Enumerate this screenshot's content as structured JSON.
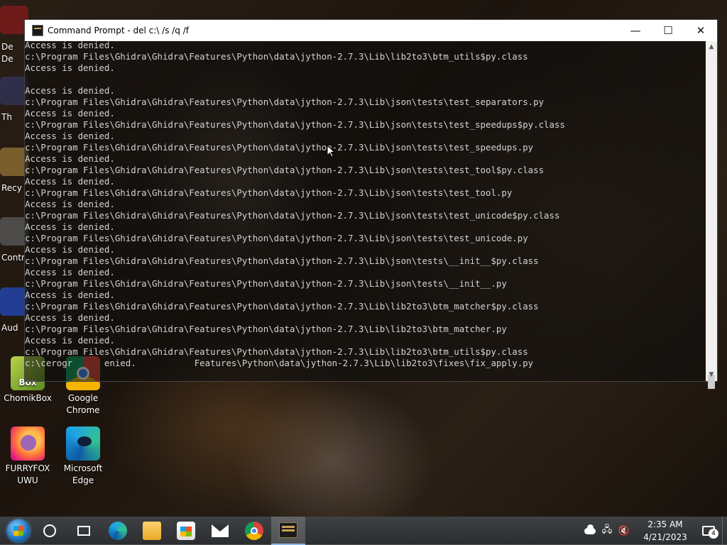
{
  "window": {
    "title": "Command Prompt - del  c:\\ /s /q /f",
    "minimize": "—",
    "maximize": "☐",
    "close": "✕"
  },
  "terminal": {
    "lines": [
      "Access is denied.",
      "c:\\Program Files\\Ghidra\\Ghidra\\Features\\Python\\data\\jython-2.7.3\\Lib\\lib2to3\\btm_utils$py.class",
      "Access is denied.",
      "",
      "Access is denied.",
      "c:\\Program Files\\Ghidra\\Ghidra\\Features\\Python\\data\\jython-2.7.3\\Lib\\json\\tests\\test_separators.py",
      "Access is denied.",
      "c:\\Program Files\\Ghidra\\Ghidra\\Features\\Python\\data\\jython-2.7.3\\Lib\\json\\tests\\test_speedups$py.class",
      "Access is denied.",
      "c:\\Program Files\\Ghidra\\Ghidra\\Features\\Python\\data\\jython-2.7.3\\Lib\\json\\tests\\test_speedups.py",
      "Access is denied.",
      "c:\\Program Files\\Ghidra\\Ghidra\\Features\\Python\\data\\jython-2.7.3\\Lib\\json\\tests\\test_tool$py.class",
      "Access is denied.",
      "c:\\Program Files\\Ghidra\\Ghidra\\Features\\Python\\data\\jython-2.7.3\\Lib\\json\\tests\\test_tool.py",
      "Access is denied.",
      "c:\\Program Files\\Ghidra\\Ghidra\\Features\\Python\\data\\jython-2.7.3\\Lib\\json\\tests\\test_unicode$py.class",
      "Access is denied.",
      "c:\\Program Files\\Ghidra\\Ghidra\\Features\\Python\\data\\jython-2.7.3\\Lib\\json\\tests\\test_unicode.py",
      "Access is denied.",
      "c:\\Program Files\\Ghidra\\Ghidra\\Features\\Python\\data\\jython-2.7.3\\Lib\\json\\tests\\__init__$py.class",
      "Access is denied.",
      "c:\\Program Files\\Ghidra\\Ghidra\\Features\\Python\\data\\jython-2.7.3\\Lib\\json\\tests\\__init__.py",
      "Access is denied.",
      "c:\\Program Files\\Ghidra\\Ghidra\\Features\\Python\\data\\jython-2.7.3\\Lib\\lib2to3\\btm_matcher$py.class",
      "Access is denied.",
      "c:\\Program Files\\Ghidra\\Ghidra\\Features\\Python\\data\\jython-2.7.3\\Lib\\lib2to3\\btm_matcher.py",
      "Access is denied.",
      "c:\\Program Files\\Ghidra\\Ghidra\\Features\\Python\\data\\jython-2.7.3\\Lib\\lib2to3\\btm_utils$py.class",
      "c:\\cerogr      enied.           Features\\Python\\data\\jython-2.7.3\\Lib\\lib2to3\\fixes\\fix_apply.py"
    ]
  },
  "desktop": {
    "icons": [
      {
        "label_1": "ChomikBox",
        "label_2": "",
        "icon": "chomikbox-icon"
      },
      {
        "label_1": "Google",
        "label_2": "Chrome",
        "icon": "chrome-icon"
      },
      {
        "label_1": "FURRYFOX",
        "label_2": "UWU",
        "icon": "firefox-icon"
      },
      {
        "label_1": "Microsoft",
        "label_2": "Edge",
        "icon": "edge-icon"
      }
    ],
    "partial_labels": [
      "De",
      "De",
      "Th",
      "Recy",
      "Contr",
      "Aud"
    ]
  },
  "taskbar": {
    "clock_time": "2:35 AM",
    "clock_date": "4/21/2023",
    "notification_count": "4",
    "pinned": [
      "search-icon",
      "task-view-icon",
      "edge-icon",
      "file-explorer-icon",
      "store-icon",
      "mail-icon",
      "chrome-icon",
      "cmd-icon"
    ]
  }
}
